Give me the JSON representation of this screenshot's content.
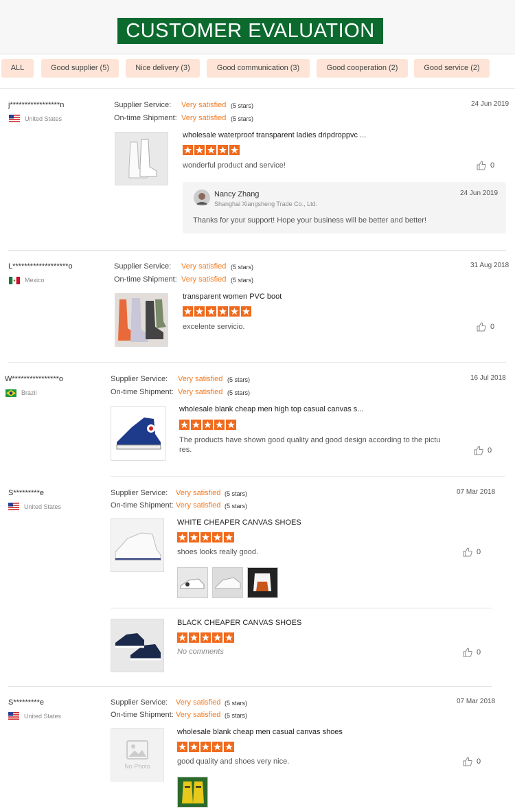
{
  "header": {
    "title": "CUSTOMER EVALUATION"
  },
  "tabs": [
    "ALL",
    "Good supplier (5)",
    "Nice delivery (3)",
    "Good communication (3)",
    "Good cooperation (2)",
    "Good service (2)"
  ],
  "labels": {
    "supplier": "Supplier Service:",
    "shipment": "On-time Shipment:",
    "satisfied": "Very satisfied",
    "stars": "(5 stars)"
  },
  "reviews": [
    {
      "user": "j*****************n",
      "country": "United States",
      "date": "24 Jun 2019",
      "product": "wholesale waterproof transparent ladies dripdroppvc ...",
      "comment": "wonderful product and service!",
      "likes": "0",
      "reply": {
        "name": "Nancy Zhang",
        "company": "Shanghai Xiangsheng Trade Co., Ltd.",
        "date": "24 Jun 2019",
        "text": "Thanks for your support! Hope your business will be better and better!"
      }
    },
    {
      "user": "L*******************o",
      "country": "Mexico",
      "date": "31 Aug 2018",
      "product": "transparent women PVC boot",
      "comment": "excelente servicio.",
      "likes": "0"
    },
    {
      "user": "W****************o",
      "country": "Brazil",
      "date": "16 Jul 2018",
      "product": "wholesale blank cheap men high top casual canvas s...",
      "comment_line1": "The products have shown good quality and good design according to the pictu",
      "comment_line2": "res.",
      "likes": "0"
    },
    {
      "user": "S*********e",
      "country": "United States",
      "date": "07 Mar 2018",
      "product": "WHITE CHEAPER CANVAS SHOES",
      "comment": "shoes looks really good.",
      "likes": "0",
      "product2": "BLACK CHEAPER CANVAS SHOES",
      "comment2": "No comments",
      "likes2": "0"
    },
    {
      "user": "S*********e",
      "country": "United States",
      "date": "07 Mar 2018",
      "product": "wholesale blank cheap men casual canvas shoes",
      "comment": "good quality and shoes very nice.",
      "likes": "0",
      "no_photo": "No Photo"
    }
  ],
  "colors": {
    "banner": "#0d6a2f",
    "accent": "#f47b20",
    "tab_bg": "#fde4d6"
  }
}
